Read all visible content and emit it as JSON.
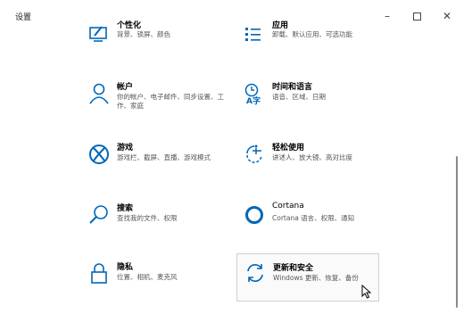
{
  "window": {
    "title": "设置"
  },
  "controls": {
    "minimize": "–",
    "close": "✕"
  },
  "tiles": [
    {
      "name": "个性化",
      "desc": "背景、锁屏、颜色",
      "icon": "personalization-icon"
    },
    {
      "name": "应用",
      "desc": "卸载、默认应用、可选功能",
      "icon": "apps-icon"
    },
    {
      "name": "帐户",
      "desc": "你的帐户、电子邮件、同步设置、工作、家庭",
      "icon": "person-icon"
    },
    {
      "name": "时间和语言",
      "desc": "语音、区域、日期",
      "icon": "time-language-icon"
    },
    {
      "name": "游戏",
      "desc": "游戏栏、截屏、直播、游戏模式",
      "icon": "xbox-icon"
    },
    {
      "name": "轻松使用",
      "desc": "讲述人、放大镜、高对比度",
      "icon": "ease-of-access-icon"
    },
    {
      "name": "搜索",
      "desc": "查找我的文件、权限",
      "icon": "search-icon"
    },
    {
      "name": "Cortana",
      "desc": "Cortana 语言、权限、通知",
      "icon": "cortana-icon"
    },
    {
      "name": "隐私",
      "desc": "位置、相机、麦克风",
      "icon": "lock-icon"
    },
    {
      "name": "更新和安全",
      "desc": "Windows 更新、恢复、备份",
      "icon": "update-icon"
    }
  ],
  "colors": {
    "accent": "#0067b8"
  }
}
